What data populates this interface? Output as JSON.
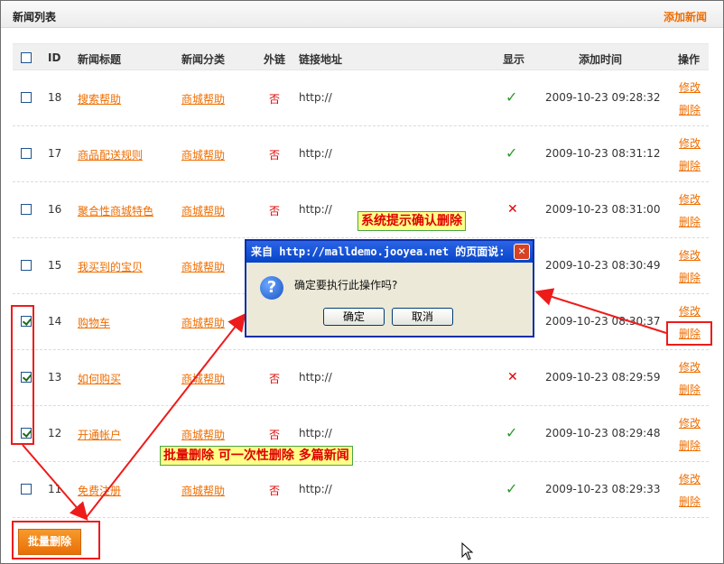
{
  "header": {
    "title": "新闻列表",
    "add_link": "添加新闻"
  },
  "columns": {
    "id": "ID",
    "title": "新闻标题",
    "category": "新闻分类",
    "external": "外链",
    "url": "链接地址",
    "show": "显示",
    "added": "添加时间",
    "ops": "操作"
  },
  "rows": [
    {
      "id": "18",
      "title": "搜索帮助",
      "category": "商城帮助",
      "external": "否",
      "url": "http://",
      "show": "✓",
      "time": "2009-10-23 09:28:32",
      "edit": "修改",
      "delete": "删除",
      "checked": false
    },
    {
      "id": "17",
      "title": "商品配送规则",
      "category": "商城帮助",
      "external": "否",
      "url": "http://",
      "show": "✓",
      "time": "2009-10-23 08:31:12",
      "edit": "修改",
      "delete": "删除",
      "checked": false
    },
    {
      "id": "16",
      "title": "聚合性商城特色",
      "category": "商城帮助",
      "external": "否",
      "url": "http://",
      "show": "✕",
      "time": "2009-10-23 08:31:00",
      "edit": "修改",
      "delete": "删除",
      "checked": false
    },
    {
      "id": "15",
      "title": "我买到的宝贝",
      "category": "商城帮助",
      "external": "",
      "url": "",
      "show": "",
      "time": "2009-10-23 08:30:49",
      "edit": "修改",
      "delete": "删除",
      "checked": false
    },
    {
      "id": "14",
      "title": "购物车",
      "category": "商城帮助",
      "external": "",
      "url": "",
      "show": "",
      "time": "2009-10-23 08:30:37",
      "edit": "修改",
      "delete": "删除",
      "checked": true
    },
    {
      "id": "13",
      "title": "如何购买",
      "category": "商城帮助",
      "external": "否",
      "url": "http://",
      "show": "✕",
      "time": "2009-10-23 08:29:59",
      "edit": "修改",
      "delete": "删除",
      "checked": true
    },
    {
      "id": "12",
      "title": "开通帐户",
      "category": "商城帮助",
      "external": "否",
      "url": "http://",
      "show": "✓",
      "time": "2009-10-23 08:29:48",
      "edit": "修改",
      "delete": "删除",
      "checked": true
    },
    {
      "id": "11",
      "title": "免费注册",
      "category": "商城帮助",
      "external": "否",
      "url": "http://",
      "show": "✓",
      "time": "2009-10-23 08:29:33",
      "edit": "修改",
      "delete": "删除",
      "checked": false
    }
  ],
  "bulk_delete_button": "批量删除",
  "callouts": {
    "confirm": "系统提示确认删除",
    "bulk": "批量删除 可一次性删除 多篇新闻"
  },
  "dialog": {
    "title": "来自 http://malldemo.jooyea.net 的页面说:",
    "close": "✕",
    "icon": "?",
    "message": "确定要执行此操作吗?",
    "ok": "确定",
    "cancel": "取消"
  },
  "colors": {
    "accent": "#ee6d00",
    "annotation_red": "#ee1b1b",
    "dialog_blue": "#0645c8"
  }
}
